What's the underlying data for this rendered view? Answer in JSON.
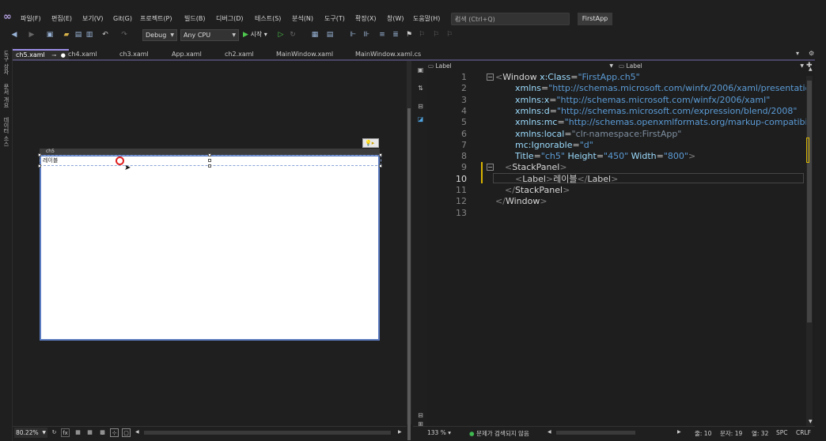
{
  "menu": {
    "items": [
      "파일(F)",
      "편집(E)",
      "보기(V)",
      "Git(G)",
      "프로젝트(P)",
      "빌드(B)",
      "디버그(D)",
      "테스트(S)",
      "분석(N)",
      "도구(T)",
      "확장(X)",
      "창(W)",
      "도움말(H)"
    ],
    "search_placeholder": "검색 (Ctrl+Q)",
    "app_title": "FirstApp"
  },
  "toolbar": {
    "configuration": "Debug",
    "platform": "Any CPU",
    "start_label": "시작"
  },
  "left_strip": [
    "도구 상자",
    "문서 개요",
    "데이터 소스"
  ],
  "tabs": [
    {
      "label": "ch5.xaml",
      "active": true
    },
    {
      "label": "ch4.xaml",
      "active": false
    },
    {
      "label": "ch3.xaml",
      "active": false
    },
    {
      "label": "App.xaml",
      "active": false
    },
    {
      "label": "ch2.xaml",
      "active": false
    },
    {
      "label": "MainWindow.xaml",
      "active": false
    },
    {
      "label": "MainWindow.xaml.cs",
      "active": false
    }
  ],
  "designer": {
    "window_title": "ch5",
    "label_content": "레이블",
    "zoom": "80.22%"
  },
  "editor": {
    "nav_left": "Label",
    "nav_right": "Label",
    "zoom": "133 %",
    "status_ok": "문제가 검색되지 않음",
    "line": "줄: 10",
    "char": "문자: 19",
    "col": "열: 32",
    "whitespace": "SPC",
    "eol": "CRLF",
    "current_line": 10,
    "lines": [
      {
        "n": "1",
        "code": "<Window x:Class=\"FirstApp.ch5\""
      },
      {
        "n": "2",
        "code": "xmlns=\"http://schemas.microsoft.com/winfx/2006/xaml/presentation\""
      },
      {
        "n": "3",
        "code": "xmlns:x=\"http://schemas.microsoft.com/winfx/2006/xaml\""
      },
      {
        "n": "4",
        "code": "xmlns:d=\"http://schemas.microsoft.com/expression/blend/2008\""
      },
      {
        "n": "5",
        "code": "xmlns:mc=\"http://schemas.openxmlformats.org/markup-compatibility/2006\""
      },
      {
        "n": "6",
        "code": "xmlns:local=\"clr-namespace:FirstApp\""
      },
      {
        "n": "7",
        "code": "mc:Ignorable=\"d\""
      },
      {
        "n": "8",
        "code": "Title=\"ch5\" Height=\"450\" Width=\"800\">"
      },
      {
        "n": "9",
        "code": "<StackPanel>"
      },
      {
        "n": "10",
        "code": "<Label>레이블</Label>"
      },
      {
        "n": "11",
        "code": "</StackPanel>"
      },
      {
        "n": "12",
        "code": "</Window>"
      },
      {
        "n": "13",
        "code": ""
      }
    ]
  }
}
